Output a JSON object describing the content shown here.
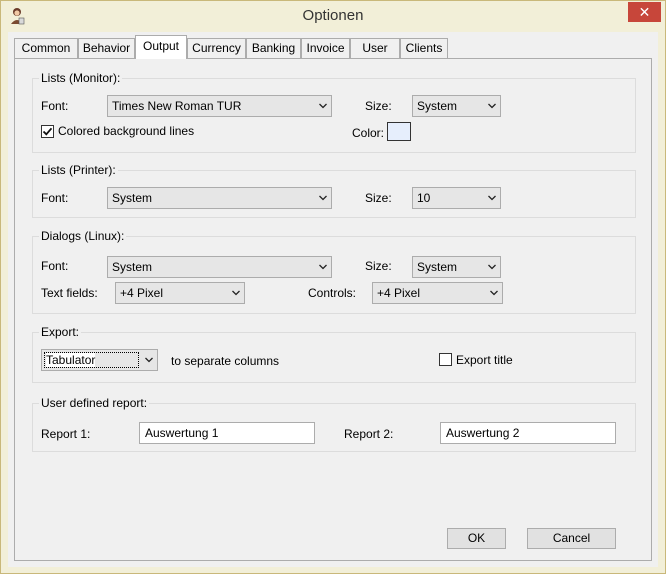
{
  "window": {
    "title": "Optionen",
    "close_label": "✕"
  },
  "tabs": [
    "Common",
    "Behavior",
    "Output",
    "Currency",
    "Banking",
    "Invoice",
    "User",
    "Clients"
  ],
  "lists_monitor": {
    "legend": "Lists (Monitor):",
    "font_label": "Font:",
    "font_value": "Times New Roman TUR",
    "size_label": "Size:",
    "size_value": "System",
    "colored_lines_label": "Colored background lines",
    "colored_lines_checked": true,
    "color_label": "Color:",
    "color_value": "#e6eefc"
  },
  "lists_printer": {
    "legend": "Lists (Printer):",
    "font_label": "Font:",
    "font_value": "System",
    "size_label": "Size:",
    "size_value": "10"
  },
  "dialogs": {
    "legend": "Dialogs (Linux):",
    "font_label": "Font:",
    "font_value": "System",
    "size_label": "Size:",
    "size_value": "System",
    "textfields_label": "Text fields:",
    "textfields_value": "+4 Pixel",
    "controls_label": "Controls:",
    "controls_value": "+4 Pixel"
  },
  "export": {
    "legend": "Export:",
    "separator_value": "Tabulator",
    "separator_suffix": "to separate columns",
    "export_title_label": "Export title",
    "export_title_checked": false
  },
  "report": {
    "legend": "User defined report:",
    "report1_label": "Report 1:",
    "report1_value": "Auswertung 1",
    "report2_label": "Report 2:",
    "report2_value": "Auswertung 2"
  },
  "buttons": {
    "ok": "OK",
    "cancel": "Cancel"
  }
}
